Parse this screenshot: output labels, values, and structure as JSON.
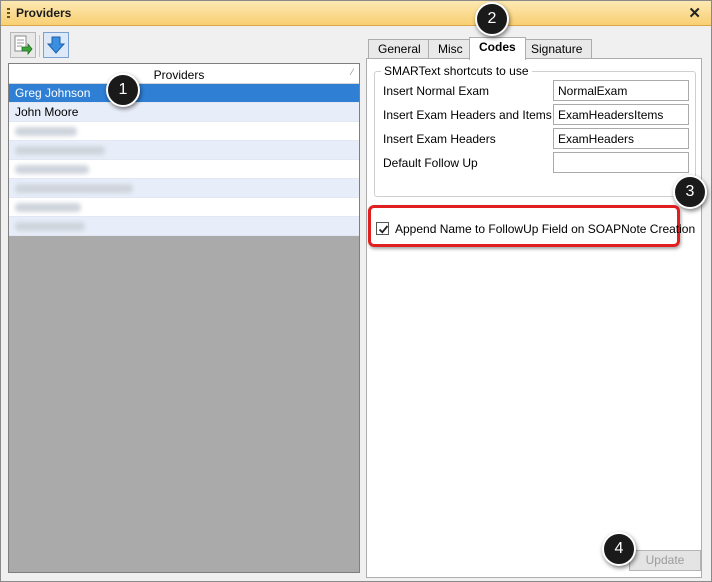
{
  "window": {
    "title": "Providers"
  },
  "list": {
    "header": "Providers",
    "providers": [
      {
        "name": "Greg Johnson",
        "selected": true
      },
      {
        "name": "John Moore",
        "selected": false
      }
    ],
    "blurred_row_count": 6
  },
  "tabs": [
    {
      "label": "General",
      "active": false
    },
    {
      "label": "Misc",
      "active": false
    },
    {
      "label": "Codes",
      "active": true
    },
    {
      "label": "Signature",
      "active": false
    }
  ],
  "codes": {
    "group_title": "SMARText shortcuts to use",
    "fields": [
      {
        "label": "Insert Normal Exam",
        "value": "NormalExam"
      },
      {
        "label": "Insert Exam Headers and Items",
        "value": "ExamHeadersItems"
      },
      {
        "label": "Insert Exam Headers",
        "value": "ExamHeaders"
      },
      {
        "label": "Default Follow Up",
        "value": ""
      }
    ],
    "append_name_checkbox": {
      "label": "Append Name to FollowUp Field on SOAPNote Creation",
      "checked": true
    }
  },
  "buttons": {
    "update": "Update",
    "close": "✕"
  },
  "callouts": [
    "1",
    "2",
    "3",
    "4"
  ],
  "colors": {
    "title_bar": "#f9cf72",
    "selection": "#2f7fd5",
    "highlight": "#e02020"
  }
}
